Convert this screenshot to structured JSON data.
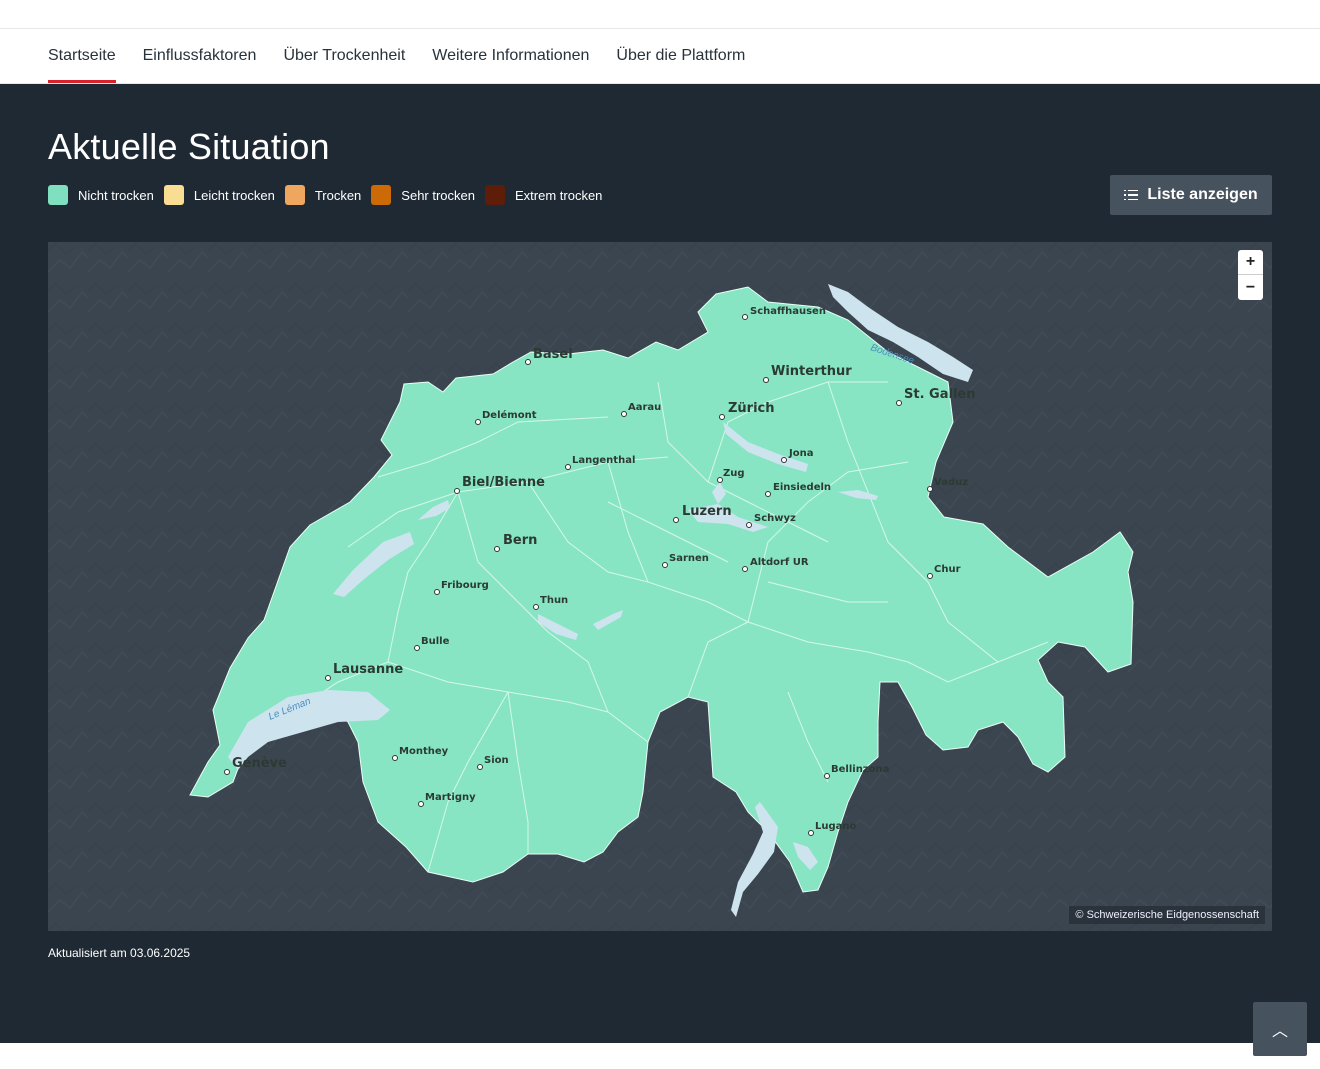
{
  "nav": {
    "tabs": [
      {
        "label": "Startseite",
        "active": true
      },
      {
        "label": "Einflussfaktoren"
      },
      {
        "label": "Über Trockenheit"
      },
      {
        "label": "Weitere Informationen"
      },
      {
        "label": "Über die Plattform"
      }
    ]
  },
  "main": {
    "title": "Aktuelle Situation",
    "legend": [
      {
        "label": "Nicht trocken",
        "color": "#7fe0c0"
      },
      {
        "label": "Leicht trocken",
        "color": "#f9dd92"
      },
      {
        "label": "Trocken",
        "color": "#efa65e"
      },
      {
        "label": "Sehr trocken",
        "color": "#cc6a08"
      },
      {
        "label": "Extrem trocken",
        "color": "#5e1d09"
      }
    ],
    "list_button": {
      "label": "Liste anzeigen",
      "icon": "list-icon"
    },
    "updated": "Aktualisiert am 03.06.2025"
  },
  "map": {
    "current_class": "Nicht trocken",
    "zoom_in": "+",
    "zoom_out": "−",
    "copyright": "© Schweizerische Eidgenossenschaft",
    "water": [
      "Bodensee",
      "Le Léman"
    ],
    "cities": [
      {
        "name": "Schaffhausen",
        "major": false
      },
      {
        "name": "Basel",
        "major": true
      },
      {
        "name": "Winterthur",
        "major": true
      },
      {
        "name": "Zürich",
        "major": true
      },
      {
        "name": "St. Gallen",
        "major": true
      },
      {
        "name": "Delémont",
        "major": false
      },
      {
        "name": "Aarau",
        "major": false
      },
      {
        "name": "Jona",
        "major": false
      },
      {
        "name": "Langenthal",
        "major": false
      },
      {
        "name": "Vaduz",
        "major": false
      },
      {
        "name": "Zug",
        "major": false
      },
      {
        "name": "Einsiedeln",
        "major": false
      },
      {
        "name": "Biel/Bienne",
        "major": true
      },
      {
        "name": "Luzern",
        "major": true
      },
      {
        "name": "Schwyz",
        "major": false
      },
      {
        "name": "Bern",
        "major": true
      },
      {
        "name": "Sarnen",
        "major": false
      },
      {
        "name": "Altdorf UR",
        "major": false
      },
      {
        "name": "Chur",
        "major": false
      },
      {
        "name": "Fribourg",
        "major": false
      },
      {
        "name": "Thun",
        "major": false
      },
      {
        "name": "Bulle",
        "major": false
      },
      {
        "name": "Lausanne",
        "major": true
      },
      {
        "name": "Monthey",
        "major": false
      },
      {
        "name": "Sion",
        "major": false
      },
      {
        "name": "Genève",
        "major": true
      },
      {
        "name": "Martigny",
        "major": false
      },
      {
        "name": "Bellinzona",
        "major": false
      },
      {
        "name": "Lugano",
        "major": false
      }
    ]
  },
  "to_top": {
    "label": "︿"
  }
}
